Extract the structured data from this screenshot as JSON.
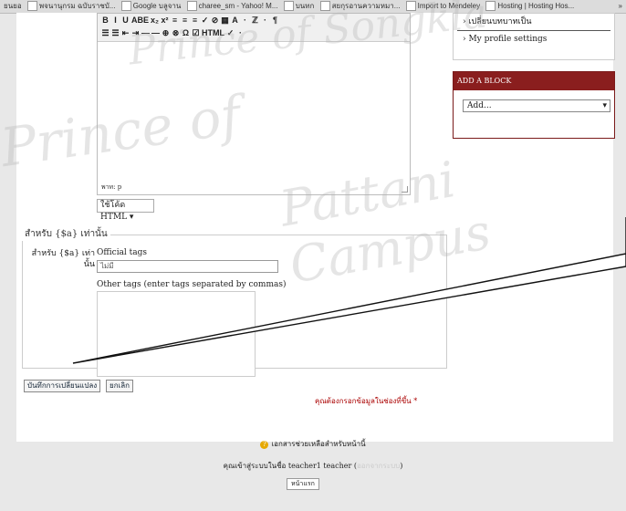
{
  "bookmarks": [
    "ยนยอ",
    "พจนานุกรม ฉบับราชบั...",
    "Google บลูจาน",
    "charee_sm - Yahoo! M...",
    "บนทก",
    "สยกุรอานความหมา...",
    "Import to Mendeley",
    "Hosting | Hosting Hos..."
  ],
  "bookmarks_more": "»",
  "editor": {
    "toolbar_row1": [
      "B",
      "I",
      "U",
      "ABE",
      "x₂",
      "x²",
      "≡",
      "≡",
      "≡",
      "✓",
      "⊘",
      "▦",
      "A",
      "·",
      "ℤ",
      "·",
      "¶"
    ],
    "toolbar_row2": [
      "☰",
      "☰",
      "⇤",
      "⇥",
      "—",
      "—",
      "⊕",
      "⊗",
      "Ω",
      "☑",
      "HTML",
      "✓",
      "·"
    ],
    "path": "พาท: p",
    "format_select": "ใช้โค้ด HTML"
  },
  "sidebar": {
    "item1": "เปลี่ยนบทบาทเป็น",
    "item2": "My profile settings",
    "block_header": "ADD A BLOCK",
    "block_select": "Add..."
  },
  "tags": {
    "legend": "สำหรับ {$a} เท่านั้น",
    "row_label_1": "สำหรับ {$a} เท่า",
    "row_label_2": "นั้น",
    "official_label": "Official tags",
    "official_value": "ไม่มี",
    "other_label": "Other tags (enter tags separated by commas)"
  },
  "buttons": {
    "save": "บันทึกการเปลี่ยนแปลง",
    "cancel": "ยกเลิก"
  },
  "required_note": "คุณต้องกรอกข้อมูลในช่องที่ขึ้น *",
  "footer": {
    "help_link": "เอกสารช่วยเหลือสำหรับหน้านี้",
    "login_prefix": "คุณเข้าสู่ระบบในชื่อ teacher1 teacher (",
    "logout_link": "ออกจากระบบ",
    "login_suffix": ")",
    "home_button": "หน้าแรก"
  },
  "watermark": [
    "Prince of Songkla",
    "Prince of",
    "Pattani Campus"
  ]
}
